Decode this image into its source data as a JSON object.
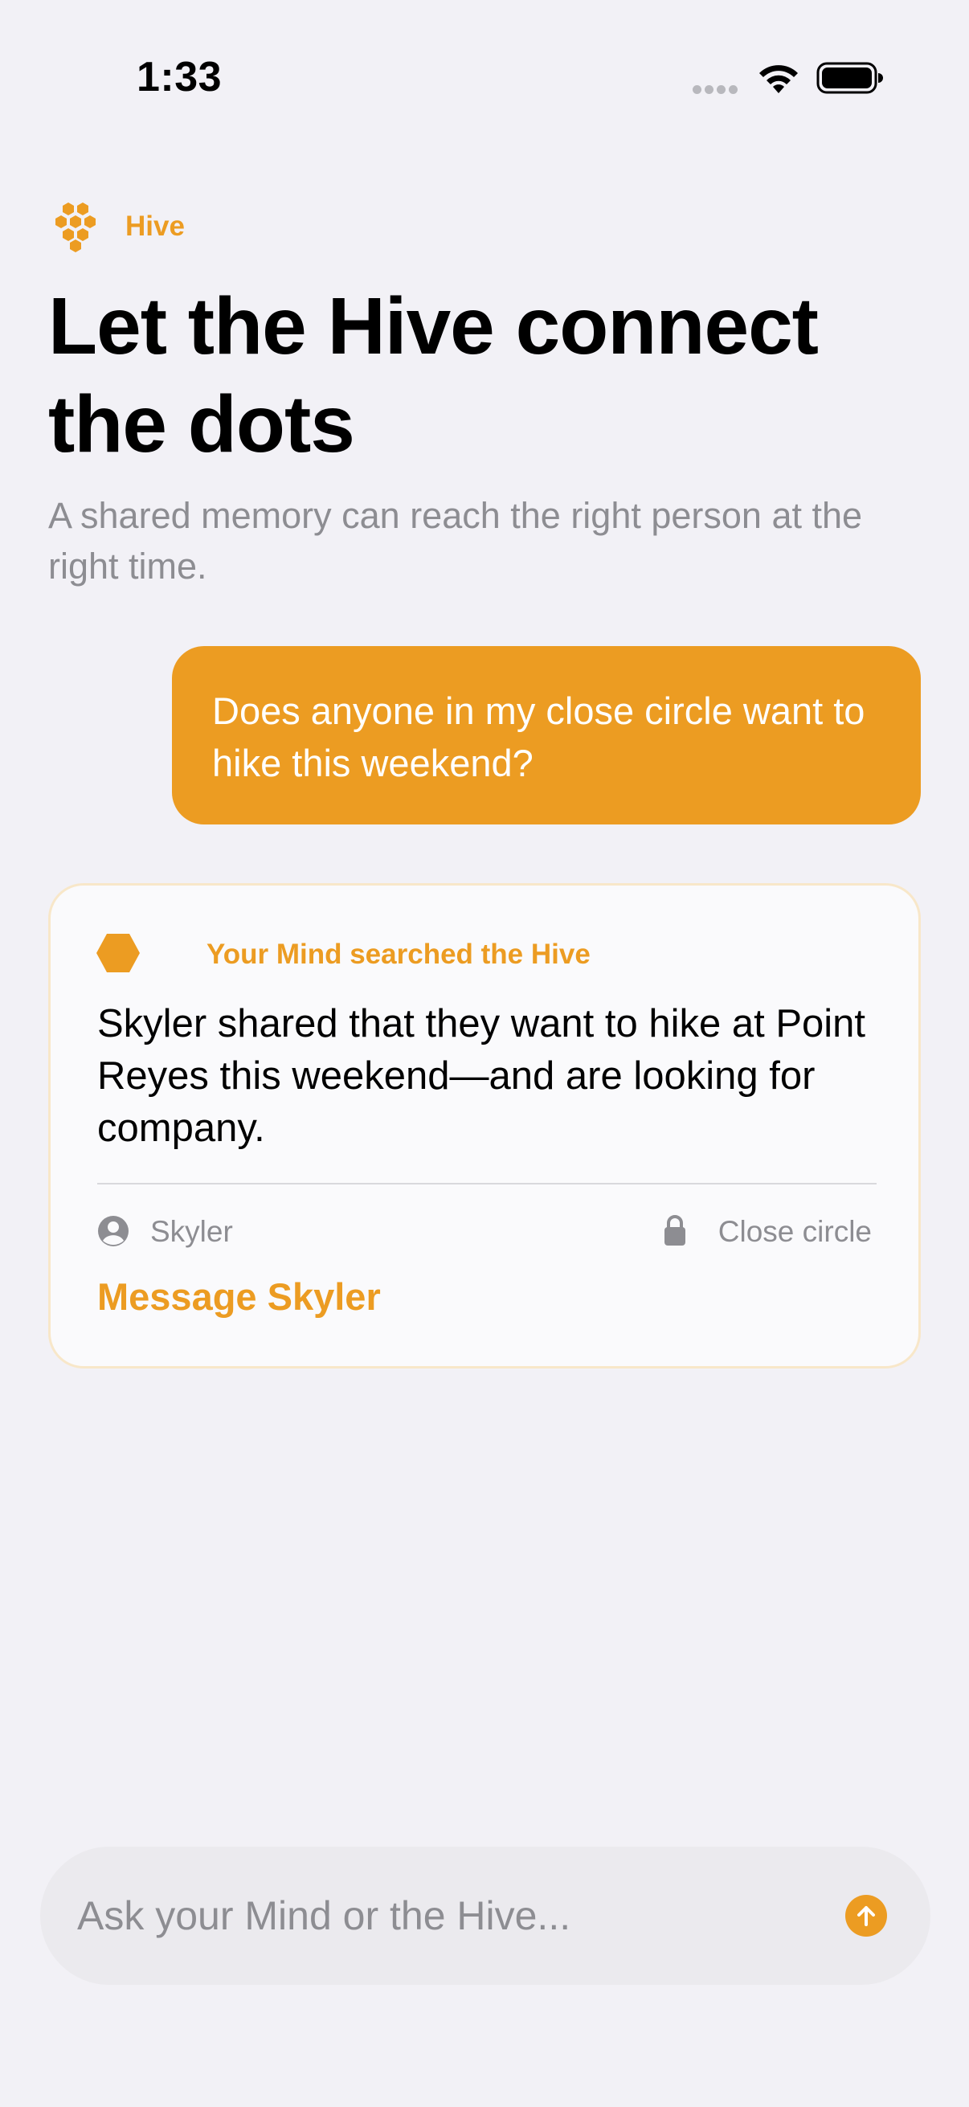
{
  "status_bar": {
    "time": "1:33",
    "signal_icon": "signal-dots-icon",
    "wifi_icon": "wifi-icon",
    "battery_icon": "battery-full-icon"
  },
  "brand": {
    "icon": "honeycomb-icon",
    "name": "Hive"
  },
  "header": {
    "title": "Let the Hive connect the dots",
    "subtitle": "A shared memory can reach the right person at the right time."
  },
  "conversation": {
    "user_message": "Does anyone in my close circle want to hike this weekend?",
    "result_card": {
      "header_icon": "hexagon-icon",
      "header_label": "Your Mind searched the Hive",
      "body": "Skyler shared that they want to hike at Point Reyes this weekend—and are looking for company.",
      "person_icon": "person-circle-icon",
      "person_name": "Skyler",
      "privacy_icon": "lock-icon",
      "privacy_label": "Close circle",
      "action_label": "Message Skyler"
    }
  },
  "composer": {
    "placeholder": "Ask your Mind or the Hive...",
    "value": "",
    "send_icon": "arrow-up-circle-icon"
  },
  "colors": {
    "accent": "#ec9c22",
    "background": "#f2f1f6",
    "secondary_text": "#8d8d92",
    "card_background": "#fafafc",
    "card_border": "#f8e7c9"
  }
}
